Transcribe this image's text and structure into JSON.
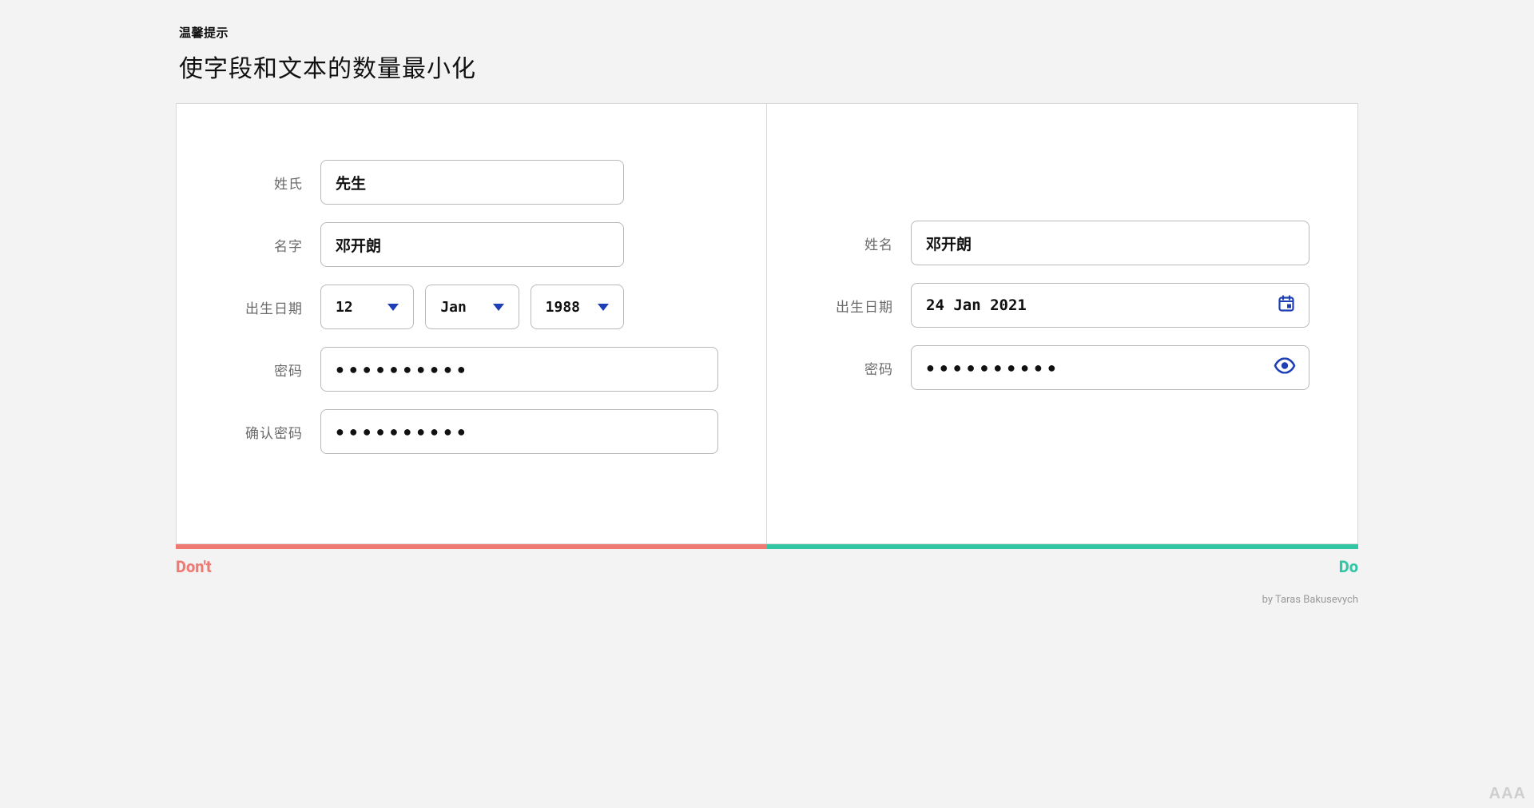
{
  "header": {
    "tag": "温馨提示",
    "title": "使字段和文本的数量最小化"
  },
  "dont": {
    "surname_label": "姓氏",
    "surname_value": "先生",
    "name_label": "名字",
    "name_value": "邓开朗",
    "dob_label": "出生日期",
    "dob_day": "12",
    "dob_month": "Jan",
    "dob_year": "1988",
    "password_label": "密码",
    "password_value": "●●●●●●●●●●",
    "confirm_label": "确认密码",
    "confirm_value": "●●●●●●●●●●"
  },
  "do": {
    "name_label": "姓名",
    "name_value": "邓开朗",
    "dob_label": "出生日期",
    "dob_value": "24 Jan 2021",
    "password_label": "密码",
    "password_value": "●●●●●●●●●●"
  },
  "footer": {
    "dont_label": "Don't",
    "do_label": "Do",
    "credit": "by Taras Bakusevych"
  },
  "watermark": "AAA",
  "colors": {
    "accent_blue": "#1e3fb5",
    "dont_red": "#ef7a73",
    "do_green": "#33c6a5"
  }
}
